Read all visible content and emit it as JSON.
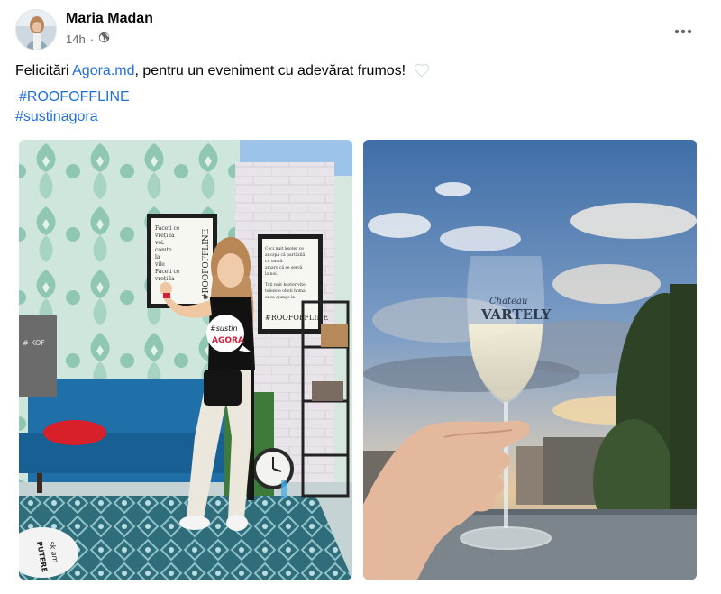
{
  "post": {
    "author": "Maria Madan",
    "time": "14h",
    "separator": "·",
    "audience_icon": "globe-icon",
    "more_icon": "more-horizontal-icon",
    "text_before": "Felicitări ",
    "mention": "Agora.md",
    "text_after": ", pentru un eveniment cu adevărat frumos!",
    "emoji": "white-heart-icon",
    "hashtags": [
      "#ROOFOFFLINE",
      "#sustinagora"
    ]
  },
  "photos": {
    "photo1": {
      "frame1_lines": [
        "Faceți ce",
        "vreți la",
        "voi.",
        "comte.",
        "la",
        "vile",
        "Faceți ce",
        "vreți la"
      ],
      "frame1_brand": "#ROOFOFFLINE",
      "frame2_lines": [
        "Ceci nuit ksoter ce",
        "anczpă că partăzilă",
        "cu oamă.",
        "amaro că se servă",
        "la noi.",
        "Toți nuit ksoter vite",
        "toiezele ohoti homa",
        "onca ajunge la"
      ],
      "frame2_brand": "#ROOFOFFLINE",
      "sign_text_1": "#sustin",
      "sign_text_2": "AGORA",
      "left_sign": "# KOF",
      "bubble_text_1": "sk am",
      "bubble_text_2": "PUTERE"
    },
    "photo2": {
      "glass_text_1": "Chateau",
      "glass_text_2": "VARTELY"
    }
  },
  "colors": {
    "link": "#216fdb",
    "meta": "#65676b",
    "sofa": "#1f6fa8",
    "sky": "#5f86b8"
  }
}
